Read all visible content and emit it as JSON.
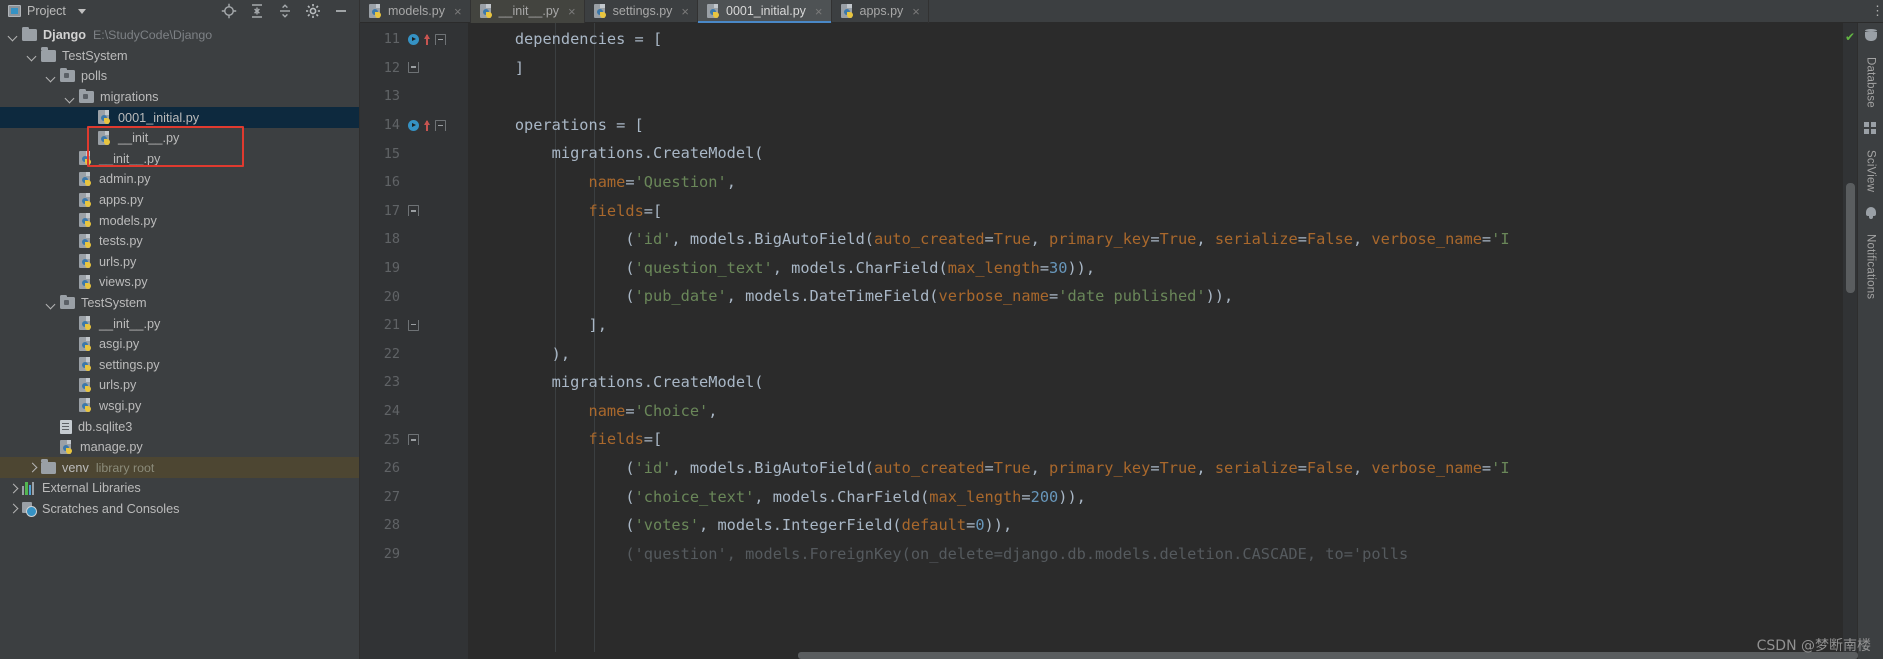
{
  "window": {
    "project_panel_title": "Project",
    "project_icon": "project-icon",
    "panel_dropdown_icon": "chevron-down-icon",
    "toolbar_icons": [
      "locate-target-icon",
      "expand-all-icon",
      "collapse-all-icon",
      "gear-icon",
      "minimize-icon"
    ]
  },
  "tabs": [
    {
      "label": "models.py",
      "icon": "python-file-icon",
      "active": false,
      "close_icon": "close-icon"
    },
    {
      "label": "__init__.py",
      "icon": "python-file-icon",
      "active": false,
      "close_icon": "close-icon"
    },
    {
      "label": "settings.py",
      "icon": "python-file-icon",
      "active": false,
      "close_icon": "close-icon"
    },
    {
      "label": "0001_initial.py",
      "icon": "python-file-icon",
      "active": true,
      "close_icon": "close-icon"
    },
    {
      "label": "apps.py",
      "icon": "python-file-icon",
      "active": false,
      "close_icon": "close-icon"
    }
  ],
  "tab_overflow_icon": "more-vertical-icon",
  "sidebar": {
    "rows": [
      {
        "label": "Django",
        "suffix": "E:\\StudyCode\\Django",
        "suffix_kind": "path",
        "icon": "folder-icon",
        "arrow": "down",
        "indent": 0,
        "bold": true,
        "state": "none"
      },
      {
        "label": "TestSystem",
        "suffix": "",
        "suffix_kind": "",
        "icon": "folder-icon",
        "arrow": "down",
        "indent": 1,
        "bold": false,
        "state": "none"
      },
      {
        "label": "polls",
        "suffix": "",
        "suffix_kind": "",
        "icon": "folder-source-icon",
        "arrow": "down",
        "indent": 2,
        "bold": false,
        "state": "none"
      },
      {
        "label": "migrations",
        "suffix": "",
        "suffix_kind": "",
        "icon": "folder-source-icon",
        "arrow": "down",
        "indent": 3,
        "bold": false,
        "state": "none"
      },
      {
        "label": "0001_initial.py",
        "suffix": "",
        "suffix_kind": "",
        "icon": "python-file-icon",
        "arrow": "none",
        "indent": 4,
        "bold": false,
        "state": "selected"
      },
      {
        "label": "__init__.py",
        "suffix": "",
        "suffix_kind": "",
        "icon": "python-file-icon",
        "arrow": "none",
        "indent": 4,
        "bold": false,
        "state": "none"
      },
      {
        "label": "__init__.py",
        "suffix": "",
        "suffix_kind": "",
        "icon": "python-file-icon",
        "arrow": "none",
        "indent": 3,
        "bold": false,
        "state": "none"
      },
      {
        "label": "admin.py",
        "suffix": "",
        "suffix_kind": "",
        "icon": "python-file-icon",
        "arrow": "none",
        "indent": 3,
        "bold": false,
        "state": "none"
      },
      {
        "label": "apps.py",
        "suffix": "",
        "suffix_kind": "",
        "icon": "python-file-icon",
        "arrow": "none",
        "indent": 3,
        "bold": false,
        "state": "none"
      },
      {
        "label": "models.py",
        "suffix": "",
        "suffix_kind": "",
        "icon": "python-file-icon",
        "arrow": "none",
        "indent": 3,
        "bold": false,
        "state": "none"
      },
      {
        "label": "tests.py",
        "suffix": "",
        "suffix_kind": "",
        "icon": "python-file-icon",
        "arrow": "none",
        "indent": 3,
        "bold": false,
        "state": "none"
      },
      {
        "label": "urls.py",
        "suffix": "",
        "suffix_kind": "",
        "icon": "python-file-icon",
        "arrow": "none",
        "indent": 3,
        "bold": false,
        "state": "none"
      },
      {
        "label": "views.py",
        "suffix": "",
        "suffix_kind": "",
        "icon": "python-file-icon",
        "arrow": "none",
        "indent": 3,
        "bold": false,
        "state": "none"
      },
      {
        "label": "TestSystem",
        "suffix": "",
        "suffix_kind": "",
        "icon": "folder-source-icon",
        "arrow": "down",
        "indent": 2,
        "bold": false,
        "state": "none"
      },
      {
        "label": "__init__.py",
        "suffix": "",
        "suffix_kind": "",
        "icon": "python-file-icon",
        "arrow": "none",
        "indent": 3,
        "bold": false,
        "state": "none"
      },
      {
        "label": "asgi.py",
        "suffix": "",
        "suffix_kind": "",
        "icon": "python-file-icon",
        "arrow": "none",
        "indent": 3,
        "bold": false,
        "state": "none"
      },
      {
        "label": "settings.py",
        "suffix": "",
        "suffix_kind": "",
        "icon": "python-file-icon",
        "arrow": "none",
        "indent": 3,
        "bold": false,
        "state": "none"
      },
      {
        "label": "urls.py",
        "suffix": "",
        "suffix_kind": "",
        "icon": "python-file-icon",
        "arrow": "none",
        "indent": 3,
        "bold": false,
        "state": "none"
      },
      {
        "label": "wsgi.py",
        "suffix": "",
        "suffix_kind": "",
        "icon": "python-file-icon",
        "arrow": "none",
        "indent": 3,
        "bold": false,
        "state": "none"
      },
      {
        "label": "db.sqlite3",
        "suffix": "",
        "suffix_kind": "",
        "icon": "database-file-icon",
        "arrow": "none",
        "indent": 2,
        "bold": false,
        "state": "none"
      },
      {
        "label": "manage.py",
        "suffix": "",
        "suffix_kind": "",
        "icon": "python-file-icon",
        "arrow": "none",
        "indent": 2,
        "bold": false,
        "state": "none"
      },
      {
        "label": "venv",
        "suffix": "library root",
        "suffix_kind": "hint",
        "icon": "folder-icon",
        "arrow": "right",
        "indent": 1,
        "bold": false,
        "state": "venv"
      },
      {
        "label": "External Libraries",
        "suffix": "",
        "suffix_kind": "",
        "icon": "libraries-icon",
        "arrow": "right",
        "indent": 0,
        "bold": false,
        "state": "none"
      },
      {
        "label": "Scratches and Consoles",
        "suffix": "",
        "suffix_kind": "",
        "icon": "scratches-icon",
        "arrow": "right",
        "indent": 0,
        "bold": false,
        "state": "none"
      }
    ],
    "annotation_color": "#e03a2f"
  },
  "editor": {
    "ok_status_icon": "inspection-ok-check",
    "lines": [
      {
        "num": "11",
        "gutter": [
          "run-icon",
          "up-arrow-icon",
          "fold-open-icon"
        ],
        "tokens": [
          {
            "t": "    dependencies = [",
            "c": "k-def"
          }
        ]
      },
      {
        "num": "12",
        "gutter": [
          "fold-end-icon"
        ],
        "tokens": [
          {
            "t": "    ]",
            "c": "k-def"
          }
        ]
      },
      {
        "num": "13",
        "gutter": [],
        "tokens": [
          {
            "t": "",
            "c": "k-def"
          }
        ]
      },
      {
        "num": "14",
        "gutter": [
          "run-icon",
          "up-arrow-icon",
          "fold-open-icon"
        ],
        "tokens": [
          {
            "t": "    operations = [",
            "c": "k-def"
          }
        ]
      },
      {
        "num": "15",
        "gutter": [],
        "tokens": [
          {
            "t": "        migrations.CreateModel(",
            "c": "k-def"
          }
        ]
      },
      {
        "num": "16",
        "gutter": [],
        "tokens": [
          {
            "t": "            ",
            "c": "k-def"
          },
          {
            "t": "name",
            "c": "k-arg"
          },
          {
            "t": "=",
            "c": "k-def"
          },
          {
            "t": "'Question'",
            "c": "k-str"
          },
          {
            "t": ",",
            "c": "k-def"
          }
        ]
      },
      {
        "num": "17",
        "gutter": [
          "fold-open-icon"
        ],
        "tokens": [
          {
            "t": "            ",
            "c": "k-def"
          },
          {
            "t": "fields",
            "c": "k-arg"
          },
          {
            "t": "=[",
            "c": "k-def"
          }
        ]
      },
      {
        "num": "18",
        "gutter": [],
        "tokens": [
          {
            "t": "                (",
            "c": "k-def"
          },
          {
            "t": "'id'",
            "c": "k-str"
          },
          {
            "t": ", models.BigAutoField(",
            "c": "k-def"
          },
          {
            "t": "auto_created",
            "c": "k-arg"
          },
          {
            "t": "=",
            "c": "k-def"
          },
          {
            "t": "True",
            "c": "k-arg"
          },
          {
            "t": ", ",
            "c": "k-def"
          },
          {
            "t": "primary_key",
            "c": "k-arg"
          },
          {
            "t": "=",
            "c": "k-def"
          },
          {
            "t": "True",
            "c": "k-arg"
          },
          {
            "t": ", ",
            "c": "k-def"
          },
          {
            "t": "serialize",
            "c": "k-arg"
          },
          {
            "t": "=",
            "c": "k-def"
          },
          {
            "t": "False",
            "c": "k-arg"
          },
          {
            "t": ", ",
            "c": "k-def"
          },
          {
            "t": "verbose_name",
            "c": "k-arg"
          },
          {
            "t": "=",
            "c": "k-def"
          },
          {
            "t": "'I",
            "c": "k-str"
          }
        ]
      },
      {
        "num": "19",
        "gutter": [],
        "tokens": [
          {
            "t": "                (",
            "c": "k-def"
          },
          {
            "t": "'question_text'",
            "c": "k-str"
          },
          {
            "t": ", models.CharField(",
            "c": "k-def"
          },
          {
            "t": "max_length",
            "c": "k-arg"
          },
          {
            "t": "=",
            "c": "k-def"
          },
          {
            "t": "30",
            "c": "k-num"
          },
          {
            "t": ")),",
            "c": "k-def"
          }
        ]
      },
      {
        "num": "20",
        "gutter": [],
        "tokens": [
          {
            "t": "                (",
            "c": "k-def"
          },
          {
            "t": "'pub_date'",
            "c": "k-str"
          },
          {
            "t": ", models.DateTimeField(",
            "c": "k-def"
          },
          {
            "t": "verbose_name",
            "c": "k-arg"
          },
          {
            "t": "=",
            "c": "k-def"
          },
          {
            "t": "'date published'",
            "c": "k-str"
          },
          {
            "t": ")),",
            "c": "k-def"
          }
        ]
      },
      {
        "num": "21",
        "gutter": [
          "fold-end-icon"
        ],
        "tokens": [
          {
            "t": "            ],",
            "c": "k-def"
          }
        ]
      },
      {
        "num": "22",
        "gutter": [],
        "tokens": [
          {
            "t": "        ),",
            "c": "k-def"
          }
        ]
      },
      {
        "num": "23",
        "gutter": [],
        "tokens": [
          {
            "t": "        migrations.CreateModel(",
            "c": "k-def"
          }
        ]
      },
      {
        "num": "24",
        "gutter": [],
        "tokens": [
          {
            "t": "            ",
            "c": "k-def"
          },
          {
            "t": "name",
            "c": "k-arg"
          },
          {
            "t": "=",
            "c": "k-def"
          },
          {
            "t": "'Choice'",
            "c": "k-str"
          },
          {
            "t": ",",
            "c": "k-def"
          }
        ]
      },
      {
        "num": "25",
        "gutter": [
          "fold-open-icon"
        ],
        "tokens": [
          {
            "t": "            ",
            "c": "k-def"
          },
          {
            "t": "fields",
            "c": "k-arg"
          },
          {
            "t": "=[",
            "c": "k-def"
          }
        ]
      },
      {
        "num": "26",
        "gutter": [],
        "tokens": [
          {
            "t": "                (",
            "c": "k-def"
          },
          {
            "t": "'id'",
            "c": "k-str"
          },
          {
            "t": ", models.BigAutoField(",
            "c": "k-def"
          },
          {
            "t": "auto_created",
            "c": "k-arg"
          },
          {
            "t": "=",
            "c": "k-def"
          },
          {
            "t": "True",
            "c": "k-arg"
          },
          {
            "t": ", ",
            "c": "k-def"
          },
          {
            "t": "primary_key",
            "c": "k-arg"
          },
          {
            "t": "=",
            "c": "k-def"
          },
          {
            "t": "True",
            "c": "k-arg"
          },
          {
            "t": ", ",
            "c": "k-def"
          },
          {
            "t": "serialize",
            "c": "k-arg"
          },
          {
            "t": "=",
            "c": "k-def"
          },
          {
            "t": "False",
            "c": "k-arg"
          },
          {
            "t": ", ",
            "c": "k-def"
          },
          {
            "t": "verbose_name",
            "c": "k-arg"
          },
          {
            "t": "=",
            "c": "k-def"
          },
          {
            "t": "'I",
            "c": "k-str"
          }
        ]
      },
      {
        "num": "27",
        "gutter": [],
        "tokens": [
          {
            "t": "                (",
            "c": "k-def"
          },
          {
            "t": "'choice_text'",
            "c": "k-str"
          },
          {
            "t": ", models.CharField(",
            "c": "k-def"
          },
          {
            "t": "max_length",
            "c": "k-arg"
          },
          {
            "t": "=",
            "c": "k-def"
          },
          {
            "t": "200",
            "c": "k-num"
          },
          {
            "t": ")),",
            "c": "k-def"
          }
        ]
      },
      {
        "num": "28",
        "gutter": [],
        "tokens": [
          {
            "t": "                (",
            "c": "k-def"
          },
          {
            "t": "'votes'",
            "c": "k-str"
          },
          {
            "t": ", models.IntegerField(",
            "c": "k-def"
          },
          {
            "t": "default",
            "c": "k-arg"
          },
          {
            "t": "=",
            "c": "k-def"
          },
          {
            "t": "0",
            "c": "k-num"
          },
          {
            "t": ")),",
            "c": "k-def"
          }
        ]
      },
      {
        "num": "29",
        "gutter": [],
        "tokens": [
          {
            "t": "                ('question', models.ForeignKey(on_delete=django.db.models.deletion.CASCADE, to='polls",
            "c": "k-dim"
          }
        ]
      }
    ]
  },
  "right_tool_window": {
    "items": [
      "Database",
      "SciView",
      "Notifications"
    ],
    "icons": [
      "database-icon",
      "grid-icon",
      "bell-icon"
    ]
  },
  "watermark": "CSDN @梦断南楼"
}
